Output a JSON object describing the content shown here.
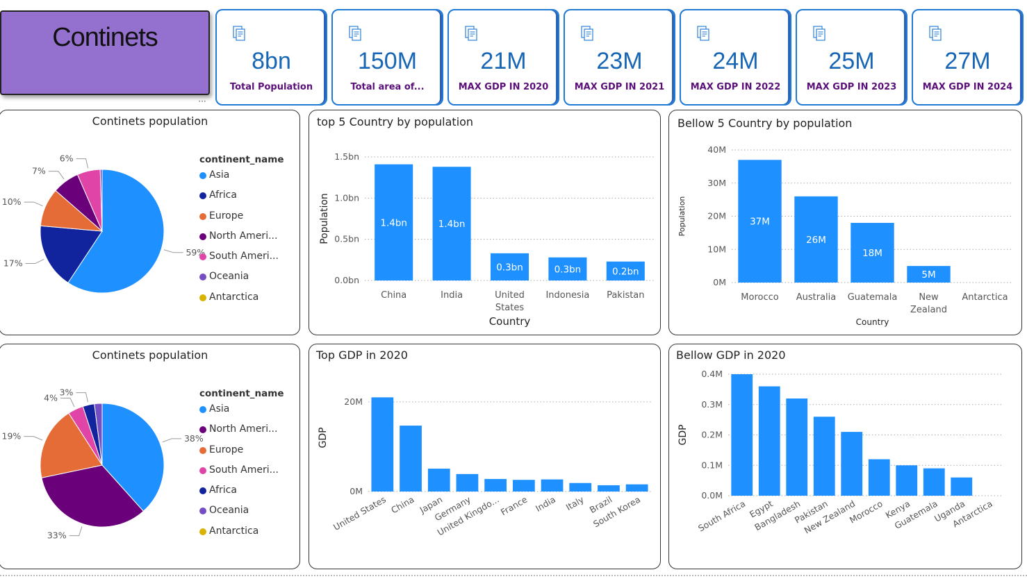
{
  "title_card": {
    "title": "Continets"
  },
  "kpis": [
    {
      "value": "8bn",
      "label": "Total Population"
    },
    {
      "value": "150M",
      "label": "Total area of..."
    },
    {
      "value": "21M",
      "label": "MAX GDP IN 2020"
    },
    {
      "value": "23M",
      "label": "MAX GDP IN 2021"
    },
    {
      "value": "24M",
      "label": "MAX GDP IN 2022"
    },
    {
      "value": "25M",
      "label": "MAX GDP IN 2023"
    },
    {
      "value": "27M",
      "label": "MAX GDP IN 2024"
    }
  ],
  "icons": {
    "kpi": "report-icon",
    "more": "more-options-icon"
  },
  "colors": {
    "accent": "#1e90ff",
    "title_card": "#9470cf",
    "kpi_value": "#1766b5",
    "kpi_label": "#5b0f7a",
    "kpi_border": "#1f7ad6"
  },
  "more_label": "···",
  "chart_data": [
    {
      "type": "pie",
      "title": "Continets population",
      "legend_title": "continent_name",
      "legend": [
        "Asia",
        "Africa",
        "Europe",
        "North Ameri...",
        "South Ameri...",
        "Oceania",
        "Antarctica"
      ],
      "legend_colors": [
        "#1e90ff",
        "#12239e",
        "#e66c37",
        "#6b007b",
        "#e044a7",
        "#744ec2",
        "#d9b300"
      ],
      "slices": [
        {
          "name": "Asia",
          "value": 59,
          "label": "59%",
          "color": "#1e90ff"
        },
        {
          "name": "Africa",
          "value": 17,
          "label": "17%",
          "color": "#12239e"
        },
        {
          "name": "Europe",
          "value": 10,
          "label": "10%",
          "color": "#e66c37"
        },
        {
          "name": "North America",
          "value": 7,
          "label": "7%",
          "color": "#6b007b"
        },
        {
          "name": "South America",
          "value": 6,
          "label": "6%",
          "color": "#e044a7"
        },
        {
          "name": "Oceania",
          "value": 0.5,
          "label": "",
          "color": "#744ec2"
        },
        {
          "name": "Antarctica",
          "value": 0,
          "label": "",
          "color": "#d9b300"
        }
      ],
      "legend_placement": "right"
    },
    {
      "type": "bar",
      "title": "top 5 Country by population",
      "xlabel": "Country",
      "ylabel": "Population",
      "categories": [
        "China",
        "India",
        "United States",
        "Indonesia",
        "Pakistan"
      ],
      "values": [
        1.41,
        1.38,
        0.33,
        0.28,
        0.23
      ],
      "data_labels": [
        "1.4bn",
        "1.4bn",
        "0.3bn",
        "0.3bn",
        "0.2bn"
      ],
      "yticks": [
        "0.0bn",
        "0.5bn",
        "1.0bn",
        "1.5bn"
      ],
      "ylim": [
        0,
        1.5
      ],
      "grid": true
    },
    {
      "type": "bar",
      "title": "Bellow 5 Country by population",
      "xlabel": "Country",
      "ylabel": "Population",
      "categories": [
        "Morocco",
        "Australia",
        "Guatemala",
        "New Zealand",
        "Antarctica"
      ],
      "values": [
        37,
        26,
        18,
        5,
        0
      ],
      "data_labels": [
        "37M",
        "26M",
        "18M",
        "5M",
        ""
      ],
      "yticks": [
        "0M",
        "10M",
        "20M",
        "30M",
        "40M"
      ],
      "ylim": [
        0,
        40
      ],
      "grid": true
    },
    {
      "type": "pie",
      "title": "Continets population",
      "legend_title": "continent_name",
      "legend": [
        "Asia",
        "North Ameri...",
        "Europe",
        "South Ameri...",
        "Africa",
        "Oceania",
        "Antarctica"
      ],
      "legend_colors": [
        "#1e90ff",
        "#6b007b",
        "#e66c37",
        "#e044a7",
        "#12239e",
        "#744ec2",
        "#d9b300"
      ],
      "slices": [
        {
          "name": "Asia",
          "value": 38,
          "label": "38%",
          "color": "#1e90ff"
        },
        {
          "name": "North America",
          "value": 33,
          "label": "33%",
          "color": "#6b007b"
        },
        {
          "name": "Europe",
          "value": 19,
          "label": "19%",
          "color": "#e66c37"
        },
        {
          "name": "South America",
          "value": 4,
          "label": "4%",
          "color": "#e044a7"
        },
        {
          "name": "Africa",
          "value": 3,
          "label": "3%",
          "color": "#12239e"
        },
        {
          "name": "Oceania",
          "value": 2,
          "label": "",
          "color": "#744ec2"
        },
        {
          "name": "Antarctica",
          "value": 0,
          "label": "",
          "color": "#d9b300"
        }
      ],
      "legend_placement": "right"
    },
    {
      "type": "bar",
      "title": "Top GDP in 2020",
      "xlabel": "",
      "ylabel": "GDP",
      "categories": [
        "United States",
        "China",
        "Japan",
        "Germany",
        "United Kingdo...",
        "France",
        "India",
        "Italy",
        "Brazil",
        "South Korea"
      ],
      "values": [
        21.0,
        14.7,
        5.1,
        3.9,
        2.8,
        2.6,
        2.7,
        1.9,
        1.4,
        1.6
      ],
      "yticks": [
        "0M",
        "20M"
      ],
      "ytick_values": [
        0,
        20
      ],
      "ylim": [
        0,
        24
      ],
      "grid": true
    },
    {
      "type": "bar",
      "title": "Bellow GDP in 2020",
      "xlabel": "",
      "ylabel": "GDP",
      "categories": [
        "South Africa",
        "Egypt",
        "Bangladesh",
        "Pakistan",
        "New Zealand",
        "Morocco",
        "Kenya",
        "Guatemala",
        "Uganda",
        "Antarctica"
      ],
      "values": [
        0.4,
        0.36,
        0.32,
        0.26,
        0.21,
        0.12,
        0.1,
        0.09,
        0.06,
        0
      ],
      "yticks": [
        "0.0M",
        "0.1M",
        "0.2M",
        "0.3M",
        "0.4M"
      ],
      "ytick_values": [
        0,
        0.1,
        0.2,
        0.3,
        0.4
      ],
      "ylim": [
        0,
        0.4
      ],
      "grid": true
    }
  ]
}
